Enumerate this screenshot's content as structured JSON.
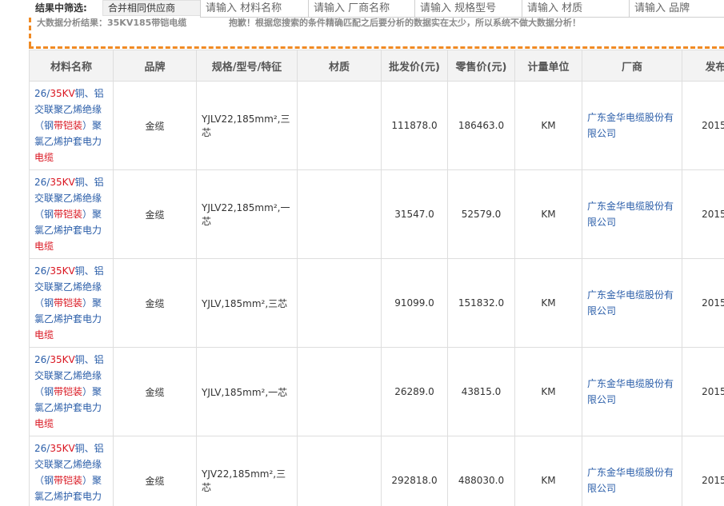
{
  "filter": {
    "label": "结果中筛选:",
    "merge_button": "合并相同供应商",
    "inputs": [
      {
        "placeholder": "请输入 材料名称"
      },
      {
        "placeholder": "请输入 厂商名称"
      },
      {
        "placeholder": "请输入 规格型号"
      },
      {
        "placeholder": "请输入 材质"
      },
      {
        "placeholder": "请输入 品牌"
      }
    ]
  },
  "notice": {
    "result_label": "大数据分析结果：35KV185带铠电缆",
    "message": "抱歉！根据您搜索的条件精确匹配之后要分析的数据实在太少，所以系统不做大数据分析！"
  },
  "table": {
    "headers": [
      "材料名称",
      "品牌",
      "规格/型号/特征",
      "材质",
      "批发价(元)",
      "零售价(元)",
      "计量单位",
      "厂商",
      "发布"
    ],
    "name_parts": {
      "p1": "26/",
      "p2": "35KV",
      "p3": "铜、铝交联聚乙烯绝缘（钢",
      "p4": "带铠装",
      "p5": "）聚氯乙烯护套电力",
      "p6": "电缆"
    },
    "rows": [
      {
        "brand": "金缆",
        "spec": "YJLV22,185mm²,三芯",
        "material": "",
        "wholesale": "111878.0",
        "retail": "186463.0",
        "unit": "KM",
        "factory": "广东金华电缆股份有限公司",
        "date": "2015-"
      },
      {
        "brand": "金缆",
        "spec": "YJLV22,185mm²,一芯",
        "material": "",
        "wholesale": "31547.0",
        "retail": "52579.0",
        "unit": "KM",
        "factory": "广东金华电缆股份有限公司",
        "date": "2015-"
      },
      {
        "brand": "金缆",
        "spec": "YJLV,185mm²,三芯",
        "material": "",
        "wholesale": "91099.0",
        "retail": "151832.0",
        "unit": "KM",
        "factory": "广东金华电缆股份有限公司",
        "date": "2015-"
      },
      {
        "brand": "金缆",
        "spec": "YJLV,185mm²,一芯",
        "material": "",
        "wholesale": "26289.0",
        "retail": "43815.0",
        "unit": "KM",
        "factory": "广东金华电缆股份有限公司",
        "date": "2015-"
      },
      {
        "brand": "金缆",
        "spec": "YJV22,185mm²,三芯",
        "material": "",
        "wholesale": "292818.0",
        "retail": "488030.0",
        "unit": "KM",
        "factory": "广东金华电缆股份有限公司",
        "date": "2015-"
      }
    ]
  },
  "colors": {
    "accent_orange": "#f08a24",
    "link_blue": "#2b5ea9",
    "highlight_red": "#d9141f"
  }
}
